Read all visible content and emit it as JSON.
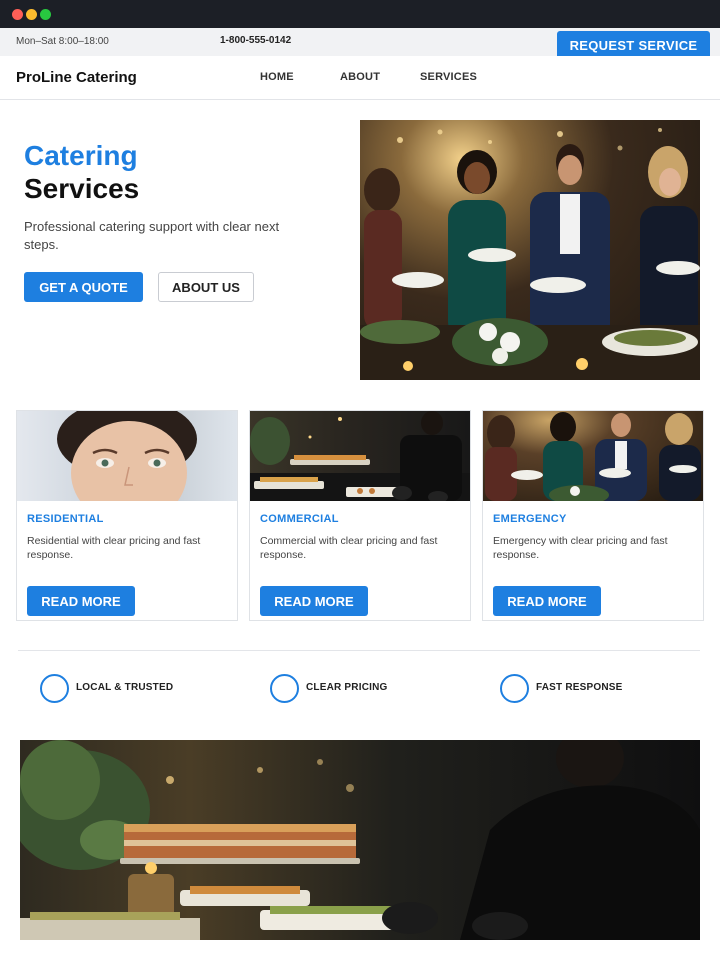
{
  "window": {
    "controls": [
      "close",
      "minimize",
      "maximize"
    ]
  },
  "topbar": {
    "hours": "Mon–Sat 8:00–18:00",
    "phone": "1-800-555-0142",
    "cta_label": "REQUEST SERVICE"
  },
  "nav": {
    "brand": "ProLine Catering",
    "links": [
      {
        "label": "HOME"
      },
      {
        "label": "ABOUT"
      },
      {
        "label": "SERVICES"
      }
    ]
  },
  "hero": {
    "title_line1": "Catering",
    "title_line2": "Services",
    "subtitle": "Professional catering support with clear next steps.",
    "primary_btn": "GET A QUOTE",
    "secondary_btn": "ABOUT US",
    "image_subject": "guests-at-buffet"
  },
  "cards": [
    {
      "heading": "RESIDENTIAL",
      "text": "Residential with clear pricing and fast response.",
      "button": "READ MORE",
      "image_subject": "smiling-woman-portrait"
    },
    {
      "heading": "COMMERCIAL",
      "text": "Commercial with clear pricing and fast response.",
      "button": "READ MORE",
      "image_subject": "chef-arranging-canapes"
    },
    {
      "heading": "EMERGENCY",
      "text": "Emergency with clear pricing and fast response.",
      "button": "READ MORE",
      "image_subject": "guests-at-buffet"
    }
  ],
  "features": [
    {
      "label": "LOCAL & TRUSTED",
      "icon": "circle-icon"
    },
    {
      "label": "CLEAR PRICING",
      "icon": "circle-icon"
    },
    {
      "label": "FAST RESPONSE",
      "icon": "circle-icon"
    }
  ],
  "bottom_image": {
    "image_subject": "chef-plating-appetizers"
  },
  "colors": {
    "accent": "#1e7fe0",
    "titlebar": "#1c1f26",
    "topbar": "#f1f2f4"
  }
}
